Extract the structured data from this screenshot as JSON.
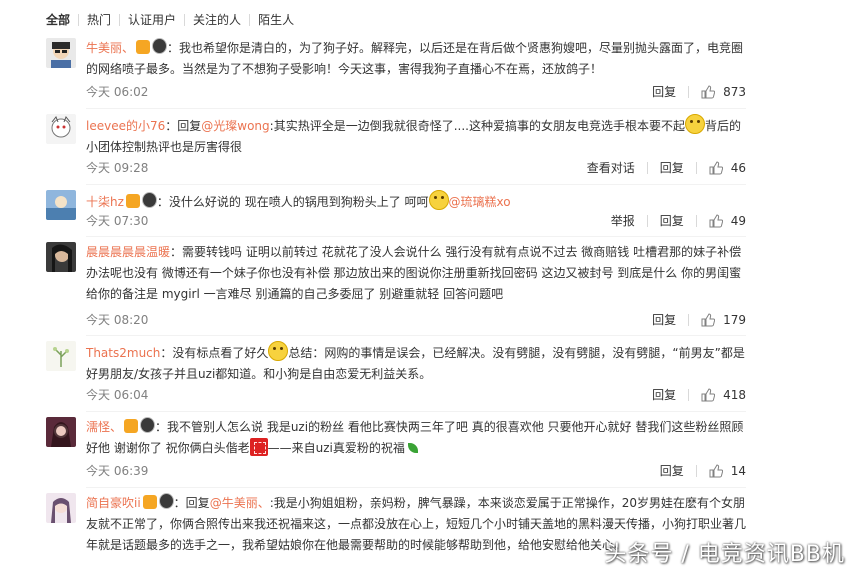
{
  "filters": [
    "全部",
    "热门",
    "认证用户",
    "关注的人",
    "陌生人"
  ],
  "comments": [
    {
      "name": "牛美丽、",
      "mention": "",
      "text": "：我也希望你是清白的，为了狗子好。解释完，以后还是在背后做个贤惠狗嫂吧，尽量别抛头露面了，电竞圈的网络喷子最多。当然是为了不想狗子受影响！今天这事，害得我狗子直播心不在焉，还放鸽子！",
      "text_after": "",
      "time": "今天 06:02",
      "actions": [
        "回复"
      ],
      "likes": "873"
    },
    {
      "name": "leevee的小76",
      "prefix": "：回复",
      "mention": "@光璨wong",
      "text": ":其实热评全是一边倒我就很奇怪了....这种爱搞事的女朋友电竞选手根本要不起",
      "text_after": "背后的小团体控制热评也是厉害得很",
      "time": "今天 09:28",
      "actions": [
        "查看对话",
        "回复"
      ],
      "likes": "46"
    },
    {
      "name": "十柒hz",
      "mention": "@琉璃糕xo",
      "text": "：没什么好说的 现在喷人的锅甩到狗粉头上了 呵呵",
      "text_after": "",
      "time": "今天 07:30",
      "actions": [
        "举报",
        "回复"
      ],
      "likes": "49"
    },
    {
      "name": "晨晨晨晨晨温暖",
      "mention": "",
      "text": "：需要转钱吗 证明以前转过 花就花了没人会说什么 强行没有就有点说不过去 微商赔钱 吐槽君那的妹子补偿办法呢也没有 微博还有一个妹子你也没有补偿 那边放出来的图说你注册重新找回密码 这边又被封号 到底是什么 你的男闺蜜给你的备注是 mygirl 一言难尽 别通篇的自己多委屈了 别避重就轻 回答问题吧",
      "text_after": "",
      "time": "今天 08:20",
      "actions": [
        "回复"
      ],
      "likes": "179"
    },
    {
      "name": "Thats2much",
      "mention": "",
      "text": "：没有标点看了好久",
      "text_after": "总结：网购的事情是误会，已经解决。没有劈腿，没有劈腿，没有劈腿，“前男友”都是好男朋友/女孩子并且uzi都知道。和小狗是自由恋爱无利益关系。",
      "time": "今天 06:04",
      "actions": [
        "回复"
      ],
      "likes": "418"
    },
    {
      "name": "濡怪、",
      "mention": "",
      "text": "：我不管别人怎么说 我是uzi的粉丝 看他比赛快两三年了吧 真的很喜欢他 只要他开心就好 替我们这些粉丝照顾好他 谢谢你了 祝你俩白头偕老",
      "text_after": "——来自uzi真爱粉的祝福",
      "time": "今天 06:39",
      "actions": [
        "回复"
      ],
      "likes": "14"
    },
    {
      "name": "简自豪吹ii",
      "prefix": "：回复",
      "mention": "@牛美丽、",
      "text": ":我是小狗姐姐粉，亲妈粉，脾气暴躁，本来谈恋爱属于正常操作，20岁男娃在麽有个女朋友就不正常了，你俩合照传出来我还祝福来这，一点都没放在心上，短短几个小时铺天盖地的黑料漫天传播，小狗打职业著几年就是话题最多的选手之一，我希望姑娘你在他最需要帮助的时候能够帮助到他，给他安慰给他关心。",
      "text_after": "",
      "time": "",
      "actions": [],
      "likes": ""
    }
  ],
  "watermark": "头条号 / 电竞资讯BB机"
}
